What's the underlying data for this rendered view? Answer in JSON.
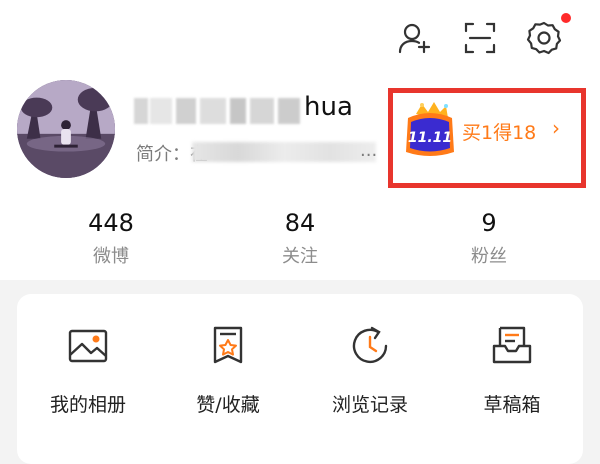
{
  "header": {
    "icons": [
      "add-friend-icon",
      "scan-icon",
      "settings-icon"
    ],
    "notification_color": "#ff2a2a"
  },
  "profile": {
    "name_visible": "hua",
    "intro_label": "简介：",
    "intro_prefix": "在",
    "intro_ellipsis": "..."
  },
  "promo": {
    "badge_text": "11.11",
    "text": "买1得18",
    "arrow": "›",
    "accent_color": "#ff7a18"
  },
  "stats": [
    {
      "value": "448",
      "label": "微博"
    },
    {
      "value": "84",
      "label": "关注"
    },
    {
      "value": "9",
      "label": "粉丝"
    }
  ],
  "shortcuts": [
    {
      "label": "我的相册",
      "icon": "photo-album-icon"
    },
    {
      "label": "赞/收藏",
      "icon": "like-favorite-icon"
    },
    {
      "label": "浏览记录",
      "icon": "history-icon"
    },
    {
      "label": "草稿箱",
      "icon": "drafts-icon"
    }
  ]
}
